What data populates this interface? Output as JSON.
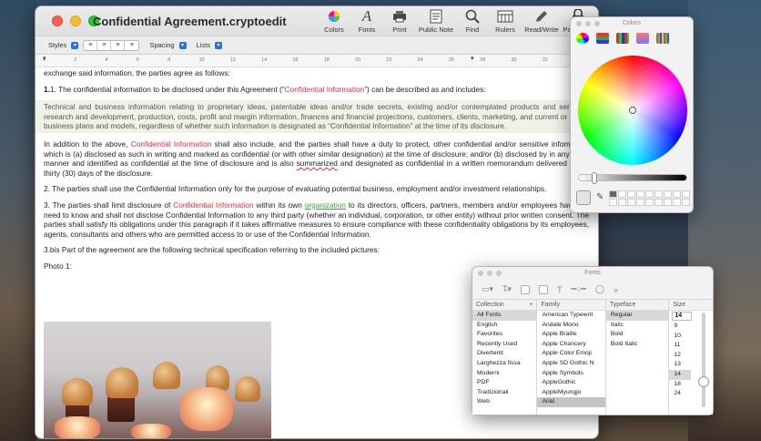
{
  "window": {
    "title": "Confidential Agreement.cryptoedit",
    "toolbar": [
      {
        "id": "colors",
        "label": "Colors",
        "icon": "color-wheel-icon"
      },
      {
        "id": "fonts",
        "label": "Fonts",
        "icon": "fonts-icon"
      },
      {
        "id": "print",
        "label": "Print",
        "icon": "printer-icon"
      },
      {
        "id": "publicnote",
        "label": "Public Note",
        "icon": "note-icon"
      },
      {
        "id": "find",
        "label": "Find",
        "icon": "magnifier-icon"
      },
      {
        "id": "rulers",
        "label": "Rulers",
        "icon": "ruler-icon"
      },
      {
        "id": "readwrite",
        "label": "Read/Write",
        "icon": "pencil-icon"
      },
      {
        "id": "password",
        "label": "Password",
        "icon": "lock-icon"
      }
    ],
    "format_bar": {
      "styles": "Styles",
      "spacing": "Spacing",
      "lists": "Lists"
    },
    "ruler_numbers": [
      "0",
      "2",
      "4",
      "6",
      "8",
      "10",
      "12",
      "14",
      "16",
      "18",
      "20",
      "22",
      "24",
      "26",
      "28",
      "30",
      "32"
    ]
  },
  "document": {
    "p0": "exchange said information, the parties agree as follows:",
    "p1_a": "1. The confidential information to be disclosed under this Agreement (“",
    "p1_red": "Confidential Information",
    "p1_b": "”) can be described as and includes:",
    "p2": "Technical and business information relating to proprietary ideas, patentable ideas and/or trade secrets, existing and/or contemplated products and services, research and development, production, costs, profit and margin information, finances and financial projections, customers, clients, marketing, and current or future business plans and models, regardless of whether such information is designated as “Confidential Information” at the time of its disclosure.",
    "p3_a": "In addition to the above, ",
    "p3_red": "Confidential Information",
    "p3_b": " shall also include, and the parties shall have a duty to protect, other confidential and/or sensitive information which is (a) disclosed as such in writing and marked as confidential (or with other similar designation) at the time of disclosure; and/or (b) disclosed by in any other manner and identified as confidential at the time of disclosure and is also ",
    "p3_spell": "summarized",
    "p3_c": " and designated as confidential in a written memorandum delivered within thirty (30) days of the disclosure.",
    "p4": "2. The parties shall use the Confidential Information only for the purpose of evaluating potential business, employment and/or investment relationships.",
    "p5_a": "3. The parties shall limit disclosure of ",
    "p5_red": "Confidential Information",
    "p5_b": " within its own ",
    "p5_green": "organization",
    "p5_c": " to its directors, officers, partners, members and/or employees having a need to know and shall not disclose Confidential Information to any third party (whether an individual, corporation, or other entity) without prior written consent. The parties shall satisfy its obligations under this paragraph if it takes affirmative measures to ensure compliance with these confidentiality obligations by its employees, agents, consultants and others who are permitted access to or use of the Confidential Information.",
    "p6": "3.bis  Part of the agreement are the following technical specification referring to the included pictures:",
    "p7": "Photo 1:"
  },
  "colors_panel": {
    "title": "Colors"
  },
  "fonts_panel": {
    "title": "Fonts",
    "collection_header": "Collection",
    "family_header": "Family",
    "typeface_header": "Typeface",
    "size_header": "Size",
    "collections": [
      "All Fonts",
      "English",
      "Favorites",
      "Recently Used",
      "Divertenti",
      "Larghezza fissa",
      "Moderni",
      "PDF",
      "Tradizionali",
      "Web"
    ],
    "families": [
      "American Typewrit",
      "Andale Mono",
      "Apple Braille",
      "Apple Chancery",
      "Apple Color Emoji",
      "Apple SD Gothic N",
      "Apple Symbols",
      "AppleGothic",
      "AppleMyungjo",
      "Arial"
    ],
    "typefaces": [
      "Regular",
      "Italic",
      "Bold",
      "Bold Italic"
    ],
    "size_value": "14",
    "sizes": [
      "9",
      "10",
      "11",
      "12",
      "13",
      "14",
      "18",
      "24"
    ]
  }
}
